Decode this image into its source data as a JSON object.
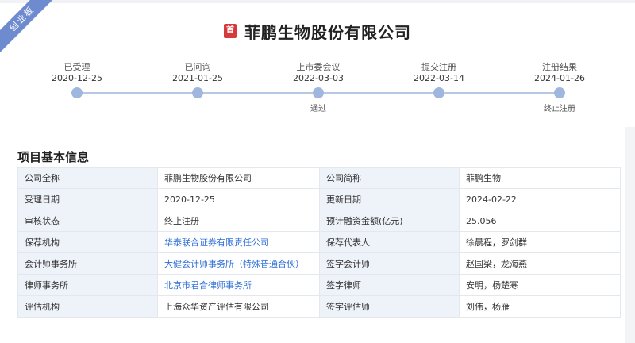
{
  "board_tag": "创业板",
  "company": {
    "logo_text": "首",
    "name": "菲鹏生物股份有限公司"
  },
  "timeline": [
    {
      "label": "已受理",
      "date": "2020-12-25",
      "note": ""
    },
    {
      "label": "已问询",
      "date": "2021-01-25",
      "note": ""
    },
    {
      "label": "上市委会议",
      "date": "2022-03-03",
      "note": "通过"
    },
    {
      "label": "提交注册",
      "date": "2022-03-14",
      "note": ""
    },
    {
      "label": "注册结果",
      "date": "2024-01-26",
      "note": "终止注册"
    }
  ],
  "section": {
    "title": "项目基本信息"
  },
  "rows": [
    {
      "k1": "公司全称",
      "v1": "菲鹏生物股份有限公司",
      "k2": "公司简称",
      "v2": "菲鹏生物"
    },
    {
      "k1": "受理日期",
      "v1": "2020-12-25",
      "k2": "更新日期",
      "v2": "2024-02-22"
    },
    {
      "k1": "审核状态",
      "v1": "终止注册",
      "k2": "预计融资金额(亿元)",
      "v2": "25.056"
    },
    {
      "k1": "保荐机构",
      "v1": "华泰联合证券有限责任公司",
      "k2": "保荐代表人",
      "v2": "徐晨程，罗剑群"
    },
    {
      "k1": "会计师事务所",
      "v1": "大健会计师事务所（特殊普通合伙）",
      "k2": "签字会计师",
      "v2": "赵国梁，龙海燕"
    },
    {
      "k1": "律师事务所",
      "v1": "北京市君合律师事务所",
      "k2": "签字律师",
      "v2": "安明，杨楚寒"
    },
    {
      "k1": "评估机构",
      "v1": "上海众华资产评估有限公司",
      "k2": "签字评估师",
      "v2": "刘伟，杨雁"
    }
  ],
  "colors": {
    "ribbon": "#6f8bd0",
    "logo": "#d43c3c",
    "link": "#2f6fd6",
    "timeline_dot": "#9fb7de",
    "key_cell": "#eef2f9"
  }
}
